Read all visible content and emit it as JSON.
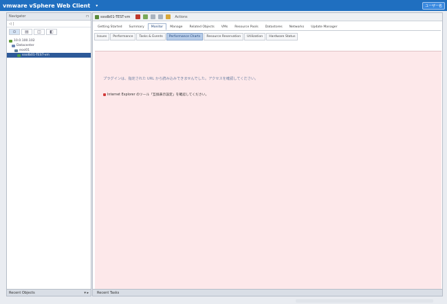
{
  "app": {
    "title": "vmware vSphere Web Client",
    "menu_icon": "dropdown-icon",
    "user_label": "ユーザー名"
  },
  "navigator": {
    "title": "Navigator",
    "back_label": "◁ |",
    "tabs": [
      "⊙",
      "▤",
      "◫",
      "◧"
    ],
    "tree": [
      {
        "label": "10.0.100.102",
        "icon": "vcenter-icon",
        "indent": 0,
        "color": "#5f9b36"
      },
      {
        "label": "Datacenter",
        "icon": "datacenter-icon",
        "indent": 1,
        "color": "#6b85b3"
      },
      {
        "label": "esxi01",
        "icon": "host-icon",
        "indent": 2,
        "color": "#5a7d9a"
      },
      {
        "label": "sssdb01-TEST-vm",
        "icon": "vm-icon",
        "indent": 3,
        "color": "#4c9a4c"
      }
    ],
    "footer_label": "Recent Objects"
  },
  "object": {
    "name": "sssdb01-TEST-vm",
    "actions_label": "Actions"
  },
  "tabs_primary": [
    {
      "label": "Getting Started",
      "active": false
    },
    {
      "label": "Summary",
      "active": false
    },
    {
      "label": "Monitor",
      "active": true
    },
    {
      "label": "Manage",
      "active": false
    },
    {
      "label": "Related Objects",
      "active": false
    },
    {
      "label": "VMs",
      "active": false
    },
    {
      "label": "Resource Pools",
      "active": false
    },
    {
      "label": "Datastores",
      "active": false
    },
    {
      "label": "Networks",
      "active": false
    },
    {
      "label": "Update Manager",
      "active": false
    }
  ],
  "tabs_secondary": [
    {
      "label": "Issues",
      "active": false
    },
    {
      "label": "Performance",
      "active": false
    },
    {
      "label": "Tasks & Events",
      "active": false
    },
    {
      "label": "Performance Charts",
      "active": true
    },
    {
      "label": "Resource Reservation",
      "active": false
    },
    {
      "label": "Utilization",
      "active": false
    },
    {
      "label": "Hardware Status",
      "active": false
    }
  ],
  "content": {
    "message_main": "プラグインは、指定された URL から読み込みできませんでした。アクセスを確認してください。",
    "message_hint": "Internet Explorer のツール「互換表示設定」を確認してください。"
  },
  "footer": {
    "label": "Recent Tasks"
  },
  "colors": {
    "topbar": "#1f6fc0",
    "content_bg": "#fde8ea",
    "selected": "#2d5a99"
  }
}
